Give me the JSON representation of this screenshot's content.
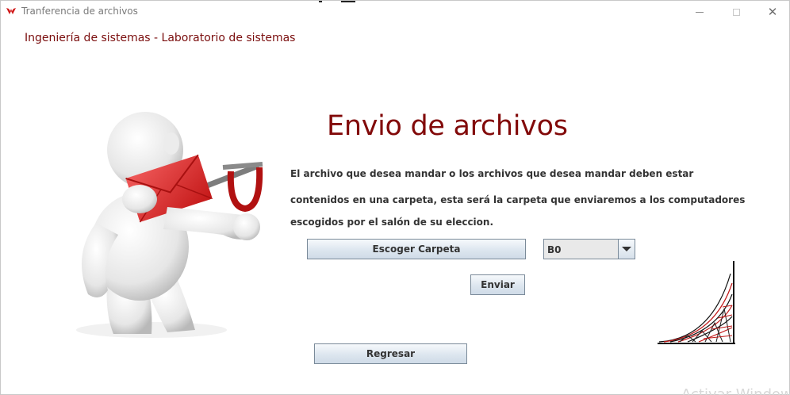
{
  "window": {
    "title": "Tranferencia de archivos"
  },
  "header": {
    "subtitle": "Ingeniería de sistemas - Laboratorio de sistemas"
  },
  "main": {
    "title": "Envio de archivos",
    "description_lines": [
      "El archivo que desea mandar o los archivos que desea mandar deben estar",
      "contenidos en una carpeta, esta será la carpeta que enviaremos a los computadores",
      "escogidos por el salón de su eleccion."
    ],
    "choose_folder_label": "Escoger Carpeta",
    "room_select": {
      "selected": "B0"
    },
    "send_label": "Enviar",
    "back_label": "Regresar"
  },
  "watermark": "Activar Windows",
  "colors": {
    "accent": "#820a0a",
    "button_border": "#7a8a99"
  }
}
